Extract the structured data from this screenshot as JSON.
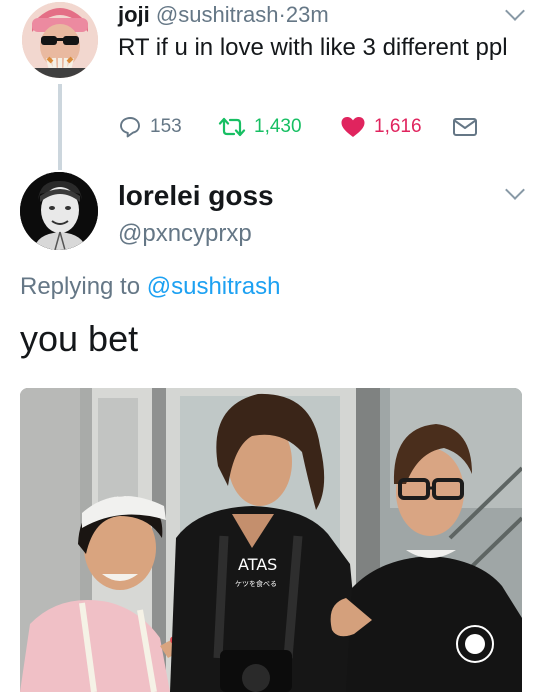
{
  "tweet1": {
    "display_name": "joji",
    "handle": "@sushitrash",
    "separator": "·",
    "time": "23m",
    "text": "RT if u in love with like 3 different ppl",
    "replies": "153",
    "retweets": "1,430",
    "likes": "1,616",
    "icons": {
      "reply": "reply-icon",
      "retweet": "retweet-icon",
      "like": "heart-icon",
      "dm": "envelope-icon",
      "menu": "chevron-down-icon"
    }
  },
  "tweet2": {
    "display_name": "lorelei goss",
    "handle": "@pxncyprxp",
    "replying_prefix": "Replying to",
    "replying_to": "@sushitrash",
    "text": "you bet",
    "shirt_print": "ケツを食べる"
  },
  "colors": {
    "text": "#14171a",
    "secondary": "#657786",
    "link": "#1da1f2",
    "retweet": "#17bf63",
    "like": "#e0245e",
    "thread_line": "#ccd6dd"
  }
}
